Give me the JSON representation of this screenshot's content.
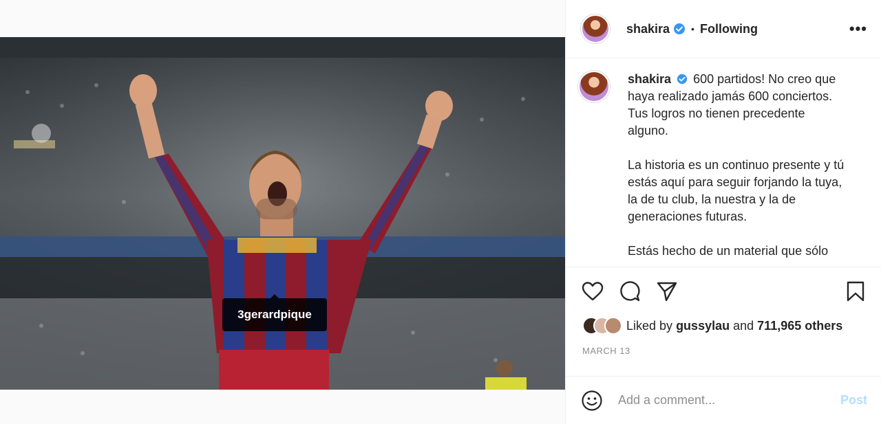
{
  "post": {
    "username": "shakira",
    "follow_state": "Following",
    "more_label": "•••",
    "dot_separator": "•",
    "photo_tag": "3gerardpique",
    "caption": {
      "username": "shakira",
      "paragraphs": [
        "600 partidos! No creo que haya realizado jamás 600 conciertos. Tus logros no tienen precedente alguno.",
        "La historia es un continuo presente y tú estás aquí para seguir forjando la tuya, la de tu club, la nuestra y la de generaciones futuras.",
        "Estás hecho de un material que sólo"
      ]
    },
    "likes": {
      "prefix": "Liked by",
      "user": "gussylau",
      "conjunction": "and",
      "others": "711,965 others"
    },
    "date": "MARCH 13"
  },
  "comment": {
    "placeholder": "Add a comment...",
    "post_label": "Post"
  },
  "colors": {
    "verified": "#3897f0",
    "post_disabled": "#b2dffc",
    "muted": "#8e8e8e"
  }
}
